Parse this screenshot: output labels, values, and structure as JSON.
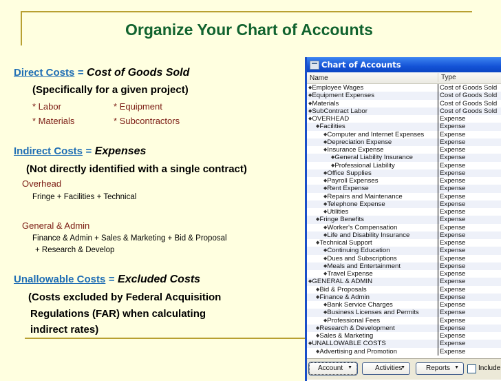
{
  "slide": {
    "title": "Organize Your Chart of Accounts",
    "colors": {
      "background": "#ffffe0",
      "title": "#11632f",
      "link": "#1f6eb4",
      "accent_rule": "#b8a032",
      "item_red": "#7a1a12"
    }
  },
  "direct": {
    "link": "Direct Costs",
    "eq": "=",
    "definition": "Cost of Goods Sold",
    "note": "(Specifically for a given project)",
    "items": [
      "* Labor",
      "* Equipment",
      "* Materials",
      "* Subcontractors"
    ]
  },
  "indirect": {
    "link": "Indirect Costs",
    "eq": "=",
    "definition": "Expenses",
    "note": "(Not directly identified with a single contract)",
    "overhead_label": "Overhead",
    "overhead_detail": "Fringe + Facilities + Technical",
    "ga_label": "General & Admin",
    "ga_detail_1": "Finance & Admin + Sales & Marketing + Bid & Proposal",
    "ga_detail_2": "+ Research & Develop"
  },
  "unallowable": {
    "link": "Unallowable Costs",
    "eq": "=",
    "definition": "Excluded Costs",
    "note_1": "(Costs excluded by Federal Acquisition",
    "note_2": "Regulations (FAR) when calculating",
    "note_3": "indirect rates)"
  },
  "window": {
    "title": "Chart of Accounts",
    "columns": {
      "name": "Name",
      "type": "Type"
    },
    "rows": [
      {
        "name": "Employee Wages",
        "level": 0,
        "type": "Cost of Goods Sold"
      },
      {
        "name": "Equipment Expenses",
        "level": 0,
        "type": "Cost of Goods Sold"
      },
      {
        "name": "Materials",
        "level": 0,
        "type": "Cost of Goods Sold"
      },
      {
        "name": "SubContract Labor",
        "level": 0,
        "type": "Cost of Goods Sold"
      },
      {
        "name": "OVERHEAD",
        "level": 0,
        "type": "Expense"
      },
      {
        "name": "Facilities",
        "level": 1,
        "type": "Expense"
      },
      {
        "name": "Computer and Internet Expenses",
        "level": 2,
        "type": "Expense"
      },
      {
        "name": "Depreciation Expense",
        "level": 2,
        "type": "Expense"
      },
      {
        "name": "Insurance Expense",
        "level": 2,
        "type": "Expense"
      },
      {
        "name": "General Liability Insurance",
        "level": 3,
        "type": "Expense"
      },
      {
        "name": "Professional Liability",
        "level": 3,
        "type": "Expense"
      },
      {
        "name": "Office Supplies",
        "level": 2,
        "type": "Expense"
      },
      {
        "name": "Payroll Expenses",
        "level": 2,
        "type": "Expense"
      },
      {
        "name": "Rent Expense",
        "level": 2,
        "type": "Expense"
      },
      {
        "name": "Repairs and Maintenance",
        "level": 2,
        "type": "Expense"
      },
      {
        "name": "Telephone Expense",
        "level": 2,
        "type": "Expense"
      },
      {
        "name": "Utilities",
        "level": 2,
        "type": "Expense"
      },
      {
        "name": "Fringe Benefits",
        "level": 1,
        "type": "Expense"
      },
      {
        "name": "Worker's Compensation",
        "level": 2,
        "type": "Expense"
      },
      {
        "name": "Life and Disability Insurance",
        "level": 2,
        "type": "Expense"
      },
      {
        "name": "Technical Support",
        "level": 1,
        "type": "Expense"
      },
      {
        "name": "Continuing Education",
        "level": 2,
        "type": "Expense"
      },
      {
        "name": "Dues and Subscriptions",
        "level": 2,
        "type": "Expense"
      },
      {
        "name": "Meals and Entertainment",
        "level": 2,
        "type": "Expense"
      },
      {
        "name": "Travel Expense",
        "level": 2,
        "type": "Expense"
      },
      {
        "name": "GENERAL & ADMIN",
        "level": 0,
        "type": "Expense"
      },
      {
        "name": "Bid & Proposals",
        "level": 1,
        "type": "Expense"
      },
      {
        "name": "Finance & Admin",
        "level": 1,
        "type": "Expense"
      },
      {
        "name": "Bank Service Charges",
        "level": 2,
        "type": "Expense"
      },
      {
        "name": "Business Licenses and Permits",
        "level": 2,
        "type": "Expense"
      },
      {
        "name": "Professional Fees",
        "level": 2,
        "type": "Expense"
      },
      {
        "name": "Research & Development",
        "level": 1,
        "type": "Expense"
      },
      {
        "name": "Sales & Marketing",
        "level": 1,
        "type": "Expense"
      },
      {
        "name": "UNALLOWABLE COSTS",
        "level": 0,
        "type": "Expense"
      },
      {
        "name": "Advertising and Promotion",
        "level": 1,
        "type": "Expense"
      }
    ],
    "buttons": {
      "account": "Account",
      "activities": "Activities",
      "reports": "Reports"
    },
    "include_checkbox": {
      "label": "Include inactive",
      "checked": false
    },
    "icons": {
      "row_marker": "diamond-bullet-icon",
      "dropdown": "triangle-down-icon",
      "window": "window-list-icon"
    }
  }
}
